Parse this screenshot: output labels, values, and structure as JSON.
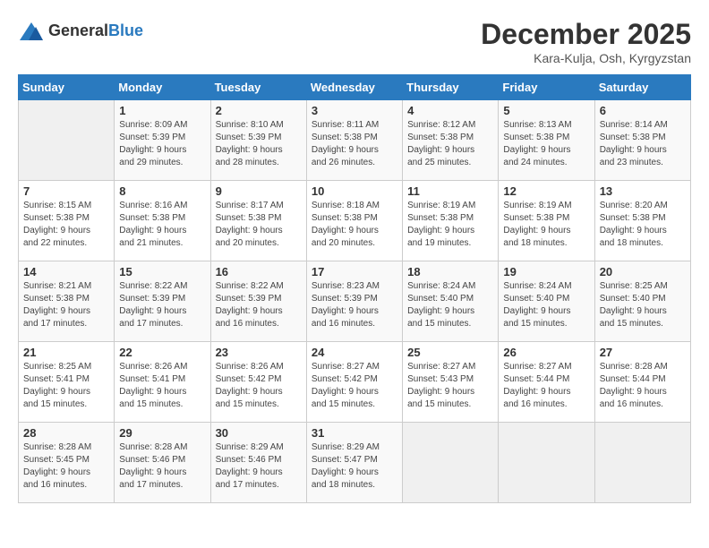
{
  "header": {
    "logo_general": "General",
    "logo_blue": "Blue",
    "month_year": "December 2025",
    "location": "Kara-Kulja, Osh, Kyrgyzstan"
  },
  "calendar": {
    "days_of_week": [
      "Sunday",
      "Monday",
      "Tuesday",
      "Wednesday",
      "Thursday",
      "Friday",
      "Saturday"
    ],
    "weeks": [
      [
        {
          "day": "",
          "info": ""
        },
        {
          "day": "1",
          "info": "Sunrise: 8:09 AM\nSunset: 5:39 PM\nDaylight: 9 hours\nand 29 minutes."
        },
        {
          "day": "2",
          "info": "Sunrise: 8:10 AM\nSunset: 5:39 PM\nDaylight: 9 hours\nand 28 minutes."
        },
        {
          "day": "3",
          "info": "Sunrise: 8:11 AM\nSunset: 5:38 PM\nDaylight: 9 hours\nand 26 minutes."
        },
        {
          "day": "4",
          "info": "Sunrise: 8:12 AM\nSunset: 5:38 PM\nDaylight: 9 hours\nand 25 minutes."
        },
        {
          "day": "5",
          "info": "Sunrise: 8:13 AM\nSunset: 5:38 PM\nDaylight: 9 hours\nand 24 minutes."
        },
        {
          "day": "6",
          "info": "Sunrise: 8:14 AM\nSunset: 5:38 PM\nDaylight: 9 hours\nand 23 minutes."
        }
      ],
      [
        {
          "day": "7",
          "info": "Sunrise: 8:15 AM\nSunset: 5:38 PM\nDaylight: 9 hours\nand 22 minutes."
        },
        {
          "day": "8",
          "info": "Sunrise: 8:16 AM\nSunset: 5:38 PM\nDaylight: 9 hours\nand 21 minutes."
        },
        {
          "day": "9",
          "info": "Sunrise: 8:17 AM\nSunset: 5:38 PM\nDaylight: 9 hours\nand 20 minutes."
        },
        {
          "day": "10",
          "info": "Sunrise: 8:18 AM\nSunset: 5:38 PM\nDaylight: 9 hours\nand 20 minutes."
        },
        {
          "day": "11",
          "info": "Sunrise: 8:19 AM\nSunset: 5:38 PM\nDaylight: 9 hours\nand 19 minutes."
        },
        {
          "day": "12",
          "info": "Sunrise: 8:19 AM\nSunset: 5:38 PM\nDaylight: 9 hours\nand 18 minutes."
        },
        {
          "day": "13",
          "info": "Sunrise: 8:20 AM\nSunset: 5:38 PM\nDaylight: 9 hours\nand 18 minutes."
        }
      ],
      [
        {
          "day": "14",
          "info": "Sunrise: 8:21 AM\nSunset: 5:38 PM\nDaylight: 9 hours\nand 17 minutes."
        },
        {
          "day": "15",
          "info": "Sunrise: 8:22 AM\nSunset: 5:39 PM\nDaylight: 9 hours\nand 17 minutes."
        },
        {
          "day": "16",
          "info": "Sunrise: 8:22 AM\nSunset: 5:39 PM\nDaylight: 9 hours\nand 16 minutes."
        },
        {
          "day": "17",
          "info": "Sunrise: 8:23 AM\nSunset: 5:39 PM\nDaylight: 9 hours\nand 16 minutes."
        },
        {
          "day": "18",
          "info": "Sunrise: 8:24 AM\nSunset: 5:40 PM\nDaylight: 9 hours\nand 15 minutes."
        },
        {
          "day": "19",
          "info": "Sunrise: 8:24 AM\nSunset: 5:40 PM\nDaylight: 9 hours\nand 15 minutes."
        },
        {
          "day": "20",
          "info": "Sunrise: 8:25 AM\nSunset: 5:40 PM\nDaylight: 9 hours\nand 15 minutes."
        }
      ],
      [
        {
          "day": "21",
          "info": "Sunrise: 8:25 AM\nSunset: 5:41 PM\nDaylight: 9 hours\nand 15 minutes."
        },
        {
          "day": "22",
          "info": "Sunrise: 8:26 AM\nSunset: 5:41 PM\nDaylight: 9 hours\nand 15 minutes."
        },
        {
          "day": "23",
          "info": "Sunrise: 8:26 AM\nSunset: 5:42 PM\nDaylight: 9 hours\nand 15 minutes."
        },
        {
          "day": "24",
          "info": "Sunrise: 8:27 AM\nSunset: 5:42 PM\nDaylight: 9 hours\nand 15 minutes."
        },
        {
          "day": "25",
          "info": "Sunrise: 8:27 AM\nSunset: 5:43 PM\nDaylight: 9 hours\nand 15 minutes."
        },
        {
          "day": "26",
          "info": "Sunrise: 8:27 AM\nSunset: 5:44 PM\nDaylight: 9 hours\nand 16 minutes."
        },
        {
          "day": "27",
          "info": "Sunrise: 8:28 AM\nSunset: 5:44 PM\nDaylight: 9 hours\nand 16 minutes."
        }
      ],
      [
        {
          "day": "28",
          "info": "Sunrise: 8:28 AM\nSunset: 5:45 PM\nDaylight: 9 hours\nand 16 minutes."
        },
        {
          "day": "29",
          "info": "Sunrise: 8:28 AM\nSunset: 5:46 PM\nDaylight: 9 hours\nand 17 minutes."
        },
        {
          "day": "30",
          "info": "Sunrise: 8:29 AM\nSunset: 5:46 PM\nDaylight: 9 hours\nand 17 minutes."
        },
        {
          "day": "31",
          "info": "Sunrise: 8:29 AM\nSunset: 5:47 PM\nDaylight: 9 hours\nand 18 minutes."
        },
        {
          "day": "",
          "info": ""
        },
        {
          "day": "",
          "info": ""
        },
        {
          "day": "",
          "info": ""
        }
      ]
    ]
  }
}
